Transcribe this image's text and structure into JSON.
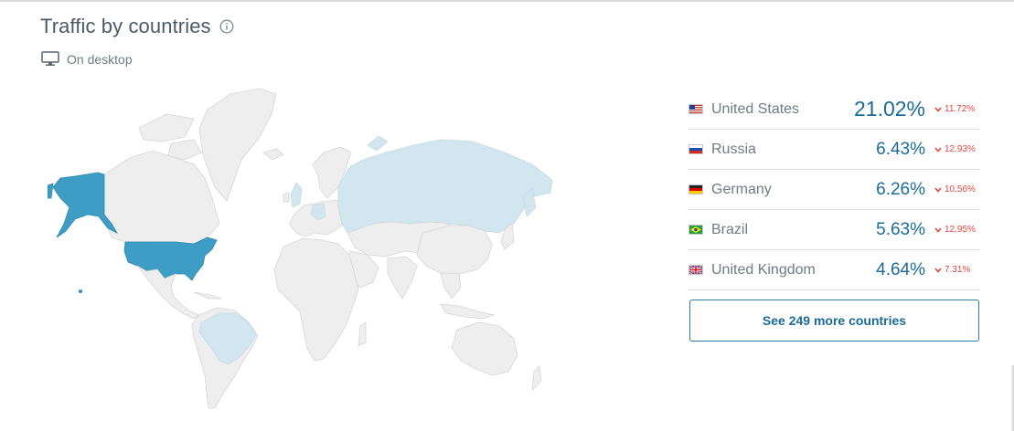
{
  "widget": {
    "title": "Traffic by countries",
    "info_icon": "info-circle-icon",
    "device_icon": "desktop-monitor-icon",
    "subtitle": "On desktop"
  },
  "map": {
    "highlight_color_strong": "#3d9dc4",
    "highlight_color_light": "#d1e6ef",
    "base_color": "#eeeeee"
  },
  "countries": [
    {
      "name": "United States",
      "share": "21.02%",
      "change": "11.72%",
      "trend": "down",
      "flag_icon": "us-flag-icon"
    },
    {
      "name": "Russia",
      "share": "6.43%",
      "change": "12.93%",
      "trend": "down",
      "flag_icon": "ru-flag-icon"
    },
    {
      "name": "Germany",
      "share": "6.26%",
      "change": "10.56%",
      "trend": "down",
      "flag_icon": "de-flag-icon"
    },
    {
      "name": "Brazil",
      "share": "5.63%",
      "change": "12.95%",
      "trend": "down",
      "flag_icon": "br-flag-icon"
    },
    {
      "name": "United Kingdom",
      "share": "4.64%",
      "change": "7.31%",
      "trend": "down",
      "flag_icon": "gb-flag-icon"
    }
  ],
  "more_button": {
    "label": "See 249 more countries"
  },
  "colors": {
    "share_text": "#1b6b9a",
    "decline": "#e2483d"
  }
}
